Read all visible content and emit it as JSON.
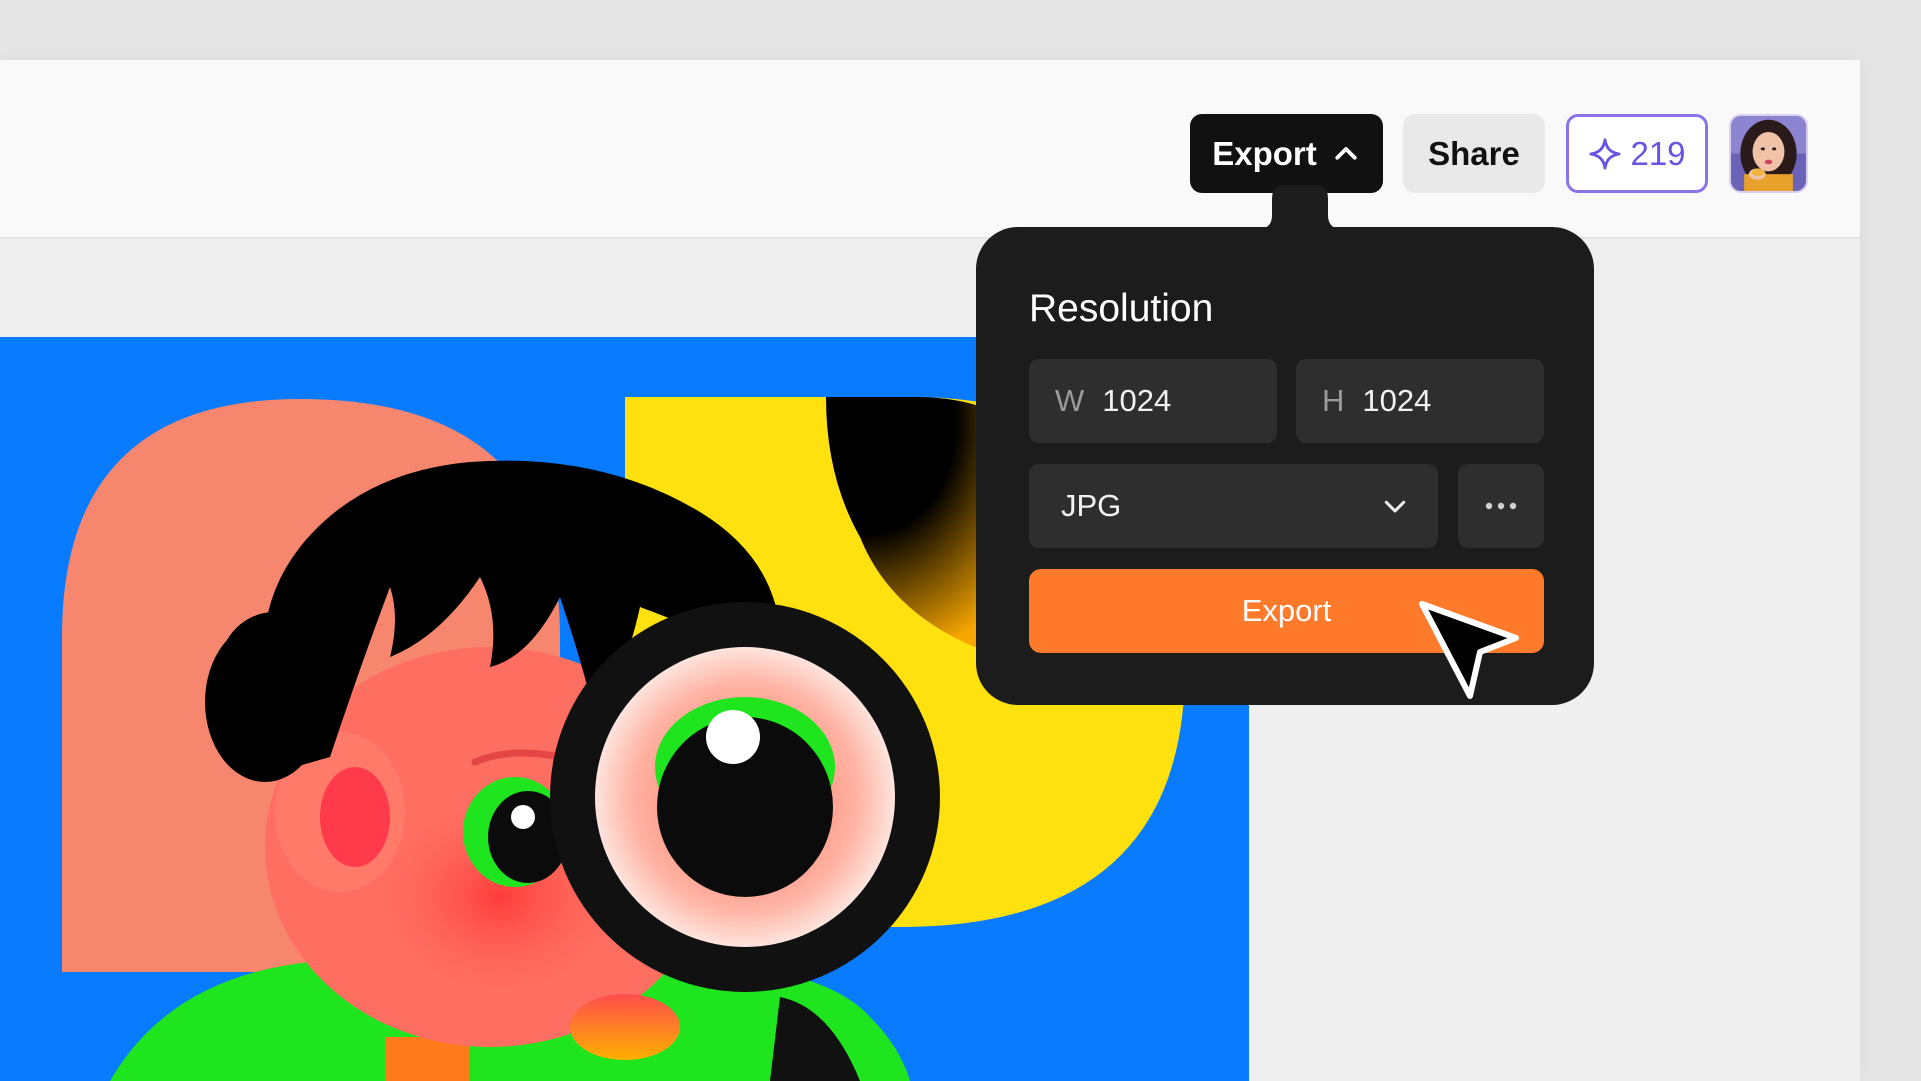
{
  "topbar": {
    "export_label": "Export",
    "share_label": "Share",
    "credits_count": "219"
  },
  "export_panel": {
    "title": "Resolution",
    "width_prefix": "W",
    "width_value": "1024",
    "height_prefix": "H",
    "height_value": "1024",
    "format_value": "JPG",
    "export_button_label": "Export"
  },
  "icons": {
    "export_toggle": "chevron-up-icon",
    "credits": "sparkle-icon",
    "format": "chevron-down-icon",
    "more": "ellipsis-icon",
    "cursor": "cursor-arrow-icon"
  },
  "colors": {
    "accent_orange": "#ff7a2b",
    "credits_purple": "#6b52e0",
    "canvas_blue": "#087bff",
    "art_yellow": "#ffe110",
    "art_salmon": "#f6876e",
    "art_green": "#1ee51e"
  }
}
